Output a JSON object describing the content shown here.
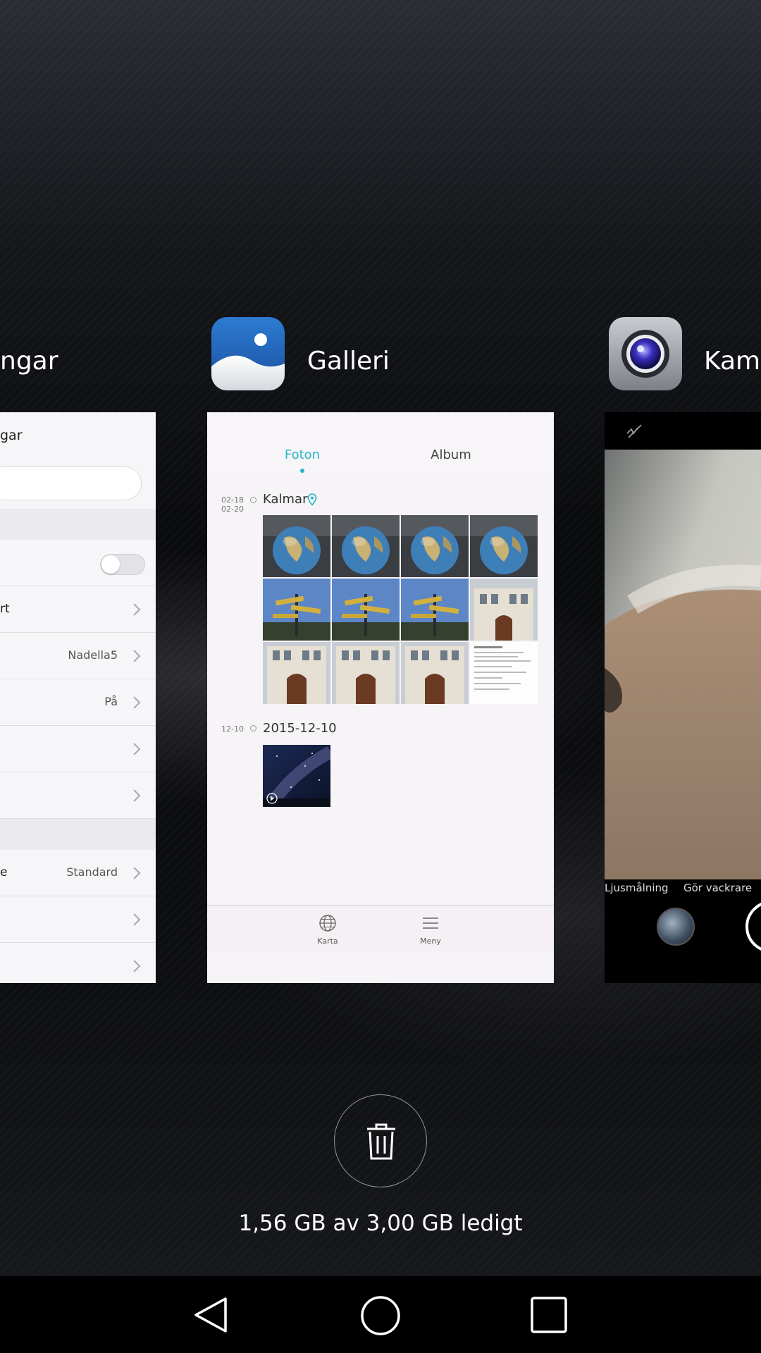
{
  "recents": {
    "apps": [
      {
        "title": "ngar",
        "icon": "settings-icon"
      },
      {
        "title": "Galleri",
        "icon": "gallery-icon"
      },
      {
        "title": "Kame",
        "icon": "camera-icon"
      }
    ]
  },
  "settings_preview": {
    "header": "gar",
    "rows": [
      {
        "label": "rt",
        "value": ""
      },
      {
        "label": "",
        "value": "Nadella5"
      },
      {
        "label": "",
        "value": "På"
      },
      {
        "label": "",
        "value": ""
      },
      {
        "label": "",
        "value": ""
      },
      {
        "label": "e",
        "value": "Standard"
      },
      {
        "label": "",
        "value": ""
      },
      {
        "label": "",
        "value": ""
      }
    ]
  },
  "galleri_preview": {
    "tabs": [
      {
        "label": "Foton",
        "active": true
      },
      {
        "label": "Album",
        "active": false
      }
    ],
    "groups": [
      {
        "date_top": "02-18",
        "date_bottom": "02-20",
        "title": "Kalmar",
        "has_location_icon": true,
        "photo_count": 12
      },
      {
        "date_top": "12-10",
        "date_bottom": "",
        "title": "2015-12-10",
        "has_location_icon": false,
        "photo_count": 1
      }
    ],
    "bottom_nav": [
      {
        "label": "Karta",
        "icon": "globe-icon"
      },
      {
        "label": "Meny",
        "icon": "menu-icon"
      }
    ],
    "accent": "#26b5c6"
  },
  "camera_preview": {
    "modes": [
      "Ljusmålning",
      "Gör vackrare"
    ]
  },
  "memory": {
    "text": "1,56 GB av 3,00 GB ledigt"
  },
  "nav_bar": {
    "buttons": [
      "back-icon",
      "home-icon",
      "recents-icon"
    ]
  }
}
